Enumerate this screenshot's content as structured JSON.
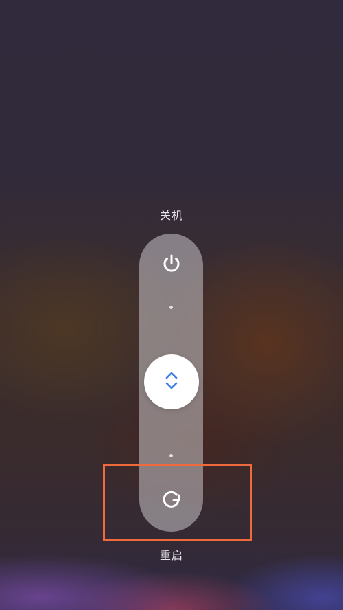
{
  "power_menu": {
    "top_label": "关机",
    "bottom_label": "重启",
    "top_icon": "power-icon",
    "bottom_icon": "restart-icon",
    "handle_icon": "chevron-up-down-icon"
  },
  "colors": {
    "accent_handle_icon": "#3b7de0",
    "highlight_border": "#ef6b3e",
    "pill_background": "#c8c4c8"
  }
}
